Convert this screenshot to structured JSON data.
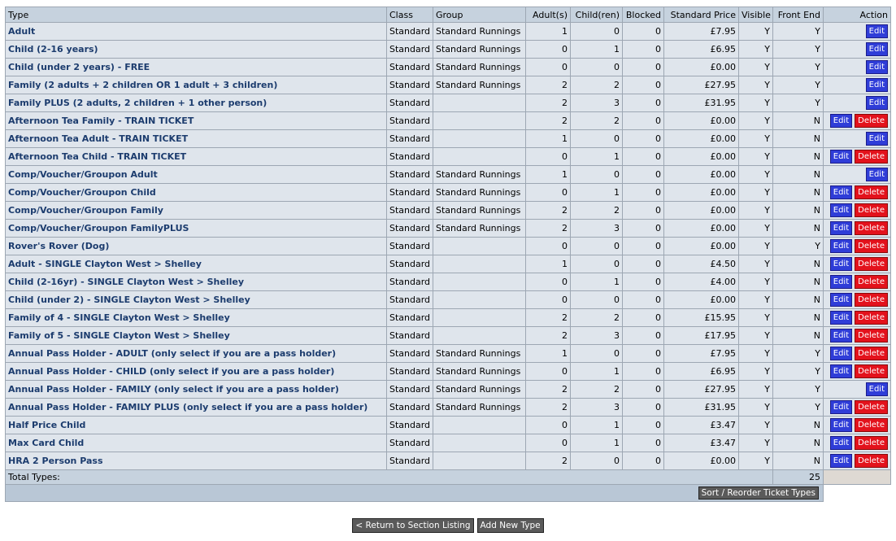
{
  "table": {
    "headers": {
      "type": "Type",
      "class": "Class",
      "group": "Group",
      "adults": "Adult(s)",
      "children": "Child(ren)",
      "blocked": "Blocked",
      "price": "Standard Price",
      "visible": "Visible",
      "frontend": "Front End",
      "action": "Action"
    },
    "edit_label": "Edit",
    "delete_label": "Delete",
    "rows": [
      {
        "type": "Adult",
        "class": "Standard",
        "group": "Standard Runnings",
        "adults": "1",
        "children": "0",
        "blocked": "0",
        "price": "£7.95",
        "visible": "Y",
        "frontend": "Y",
        "deletable": false
      },
      {
        "type": "Child (2-16 years)",
        "class": "Standard",
        "group": "Standard Runnings",
        "adults": "0",
        "children": "1",
        "blocked": "0",
        "price": "£6.95",
        "visible": "Y",
        "frontend": "Y",
        "deletable": false
      },
      {
        "type": "Child (under 2 years) - FREE",
        "class": "Standard",
        "group": "Standard Runnings",
        "adults": "0",
        "children": "0",
        "blocked": "0",
        "price": "£0.00",
        "visible": "Y",
        "frontend": "Y",
        "deletable": false
      },
      {
        "type": "Family (2 adults + 2 children OR 1 adult + 3 children)",
        "class": "Standard",
        "group": "Standard Runnings",
        "adults": "2",
        "children": "2",
        "blocked": "0",
        "price": "£27.95",
        "visible": "Y",
        "frontend": "Y",
        "deletable": false
      },
      {
        "type": "Family PLUS (2 adults, 2 children + 1 other person)",
        "class": "Standard",
        "group": "",
        "adults": "2",
        "children": "3",
        "blocked": "0",
        "price": "£31.95",
        "visible": "Y",
        "frontend": "Y",
        "deletable": false
      },
      {
        "type": "Afternoon Tea Family - TRAIN TICKET",
        "class": "Standard",
        "group": "",
        "adults": "2",
        "children": "2",
        "blocked": "0",
        "price": "£0.00",
        "visible": "Y",
        "frontend": "N",
        "deletable": true
      },
      {
        "type": "Afternoon Tea Adult - TRAIN TICKET",
        "class": "Standard",
        "group": "",
        "adults": "1",
        "children": "0",
        "blocked": "0",
        "price": "£0.00",
        "visible": "Y",
        "frontend": "N",
        "deletable": false
      },
      {
        "type": "Afternoon Tea Child - TRAIN TICKET",
        "class": "Standard",
        "group": "",
        "adults": "0",
        "children": "1",
        "blocked": "0",
        "price": "£0.00",
        "visible": "Y",
        "frontend": "N",
        "deletable": true
      },
      {
        "type": "Comp/Voucher/Groupon Adult",
        "class": "Standard",
        "group": "Standard Runnings",
        "adults": "1",
        "children": "0",
        "blocked": "0",
        "price": "£0.00",
        "visible": "Y",
        "frontend": "N",
        "deletable": false
      },
      {
        "type": "Comp/Voucher/Groupon Child",
        "class": "Standard",
        "group": "Standard Runnings",
        "adults": "0",
        "children": "1",
        "blocked": "0",
        "price": "£0.00",
        "visible": "Y",
        "frontend": "N",
        "deletable": true
      },
      {
        "type": "Comp/Voucher/Groupon Family",
        "class": "Standard",
        "group": "Standard Runnings",
        "adults": "2",
        "children": "2",
        "blocked": "0",
        "price": "£0.00",
        "visible": "Y",
        "frontend": "N",
        "deletable": true
      },
      {
        "type": "Comp/Voucher/Groupon FamilyPLUS",
        "class": "Standard",
        "group": "Standard Runnings",
        "adults": "2",
        "children": "3",
        "blocked": "0",
        "price": "£0.00",
        "visible": "Y",
        "frontend": "N",
        "deletable": true
      },
      {
        "type": "Rover's Rover (Dog)",
        "class": "Standard",
        "group": "",
        "adults": "0",
        "children": "0",
        "blocked": "0",
        "price": "£0.00",
        "visible": "Y",
        "frontend": "Y",
        "deletable": true
      },
      {
        "type": "Adult - SINGLE Clayton West > Shelley",
        "class": "Standard",
        "group": "",
        "adults": "1",
        "children": "0",
        "blocked": "0",
        "price": "£4.50",
        "visible": "Y",
        "frontend": "N",
        "deletable": true
      },
      {
        "type": "Child (2-16yr) - SINGLE Clayton West > Shelley",
        "class": "Standard",
        "group": "",
        "adults": "0",
        "children": "1",
        "blocked": "0",
        "price": "£4.00",
        "visible": "Y",
        "frontend": "N",
        "deletable": true
      },
      {
        "type": "Child (under 2) - SINGLE Clayton West > Shelley",
        "class": "Standard",
        "group": "",
        "adults": "0",
        "children": "0",
        "blocked": "0",
        "price": "£0.00",
        "visible": "Y",
        "frontend": "N",
        "deletable": true
      },
      {
        "type": "Family of 4 - SINGLE Clayton West > Shelley",
        "class": "Standard",
        "group": "",
        "adults": "2",
        "children": "2",
        "blocked": "0",
        "price": "£15.95",
        "visible": "Y",
        "frontend": "N",
        "deletable": true
      },
      {
        "type": "Family of 5 - SINGLE Clayton West > Shelley",
        "class": "Standard",
        "group": "",
        "adults": "2",
        "children": "3",
        "blocked": "0",
        "price": "£17.95",
        "visible": "Y",
        "frontend": "N",
        "deletable": true
      },
      {
        "type": "Annual Pass Holder - ADULT (only select if you are a pass holder)",
        "class": "Standard",
        "group": "Standard Runnings",
        "adults": "1",
        "children": "0",
        "blocked": "0",
        "price": "£7.95",
        "visible": "Y",
        "frontend": "Y",
        "deletable": true
      },
      {
        "type": "Annual Pass Holder - CHILD (only select if you are a pass holder)",
        "class": "Standard",
        "group": "Standard Runnings",
        "adults": "0",
        "children": "1",
        "blocked": "0",
        "price": "£6.95",
        "visible": "Y",
        "frontend": "Y",
        "deletable": true
      },
      {
        "type": "Annual Pass Holder - FAMILY (only select if you are a pass holder)",
        "class": "Standard",
        "group": "Standard Runnings",
        "adults": "2",
        "children": "2",
        "blocked": "0",
        "price": "£27.95",
        "visible": "Y",
        "frontend": "Y",
        "deletable": false
      },
      {
        "type": "Annual Pass Holder - FAMILY PLUS (only select if you are a pass holder)",
        "class": "Standard",
        "group": "Standard Runnings",
        "adults": "2",
        "children": "3",
        "blocked": "0",
        "price": "£31.95",
        "visible": "Y",
        "frontend": "Y",
        "deletable": true
      },
      {
        "type": "Half Price Child",
        "class": "Standard",
        "group": "",
        "adults": "0",
        "children": "1",
        "blocked": "0",
        "price": "£3.47",
        "visible": "Y",
        "frontend": "N",
        "deletable": true
      },
      {
        "type": "Max Card Child",
        "class": "Standard",
        "group": "",
        "adults": "0",
        "children": "1",
        "blocked": "0",
        "price": "£3.47",
        "visible": "Y",
        "frontend": "N",
        "deletable": true
      },
      {
        "type": "HRA 2 Person Pass",
        "class": "Standard",
        "group": "",
        "adults": "2",
        "children": "0",
        "blocked": "0",
        "price": "£0.00",
        "visible": "Y",
        "frontend": "N",
        "deletable": true
      }
    ],
    "total_label": "Total Types:",
    "total_value": "25",
    "sort_button": "Sort / Reorder Ticket Types"
  },
  "footer": {
    "return_button": "< Return to Section Listing",
    "add_button": "Add New Type"
  },
  "colors": {
    "header_bg": "#c6d2de",
    "row_bg": "#dfe5ec",
    "type_text": "#1c3c6e",
    "edit_button": "#2f3dd8",
    "delete_button": "#e3121c"
  }
}
